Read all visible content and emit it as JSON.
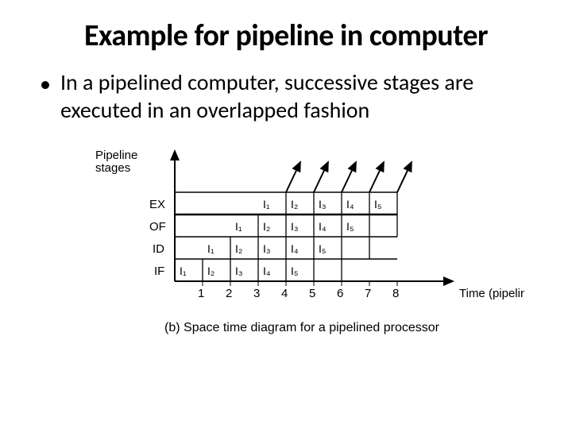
{
  "title": "Example for pipeline in computer",
  "bullet_text": "In a pipelined computer, successive stages are executed in an overlapped fashion",
  "diagram": {
    "y_axis_label": "Pipeline\nstages",
    "x_axis_label": "Time (pipeline cycle)",
    "caption": "(b) Space time diagram for a pipelined processor",
    "stages": [
      "EX",
      "OF",
      "ID",
      "IF"
    ],
    "cycles": [
      "1",
      "2",
      "3",
      "4",
      "5",
      "6",
      "7",
      "8"
    ],
    "cells": {
      "EX": [
        "",
        "",
        "",
        "I₁",
        "I₂",
        "I₃",
        "I₄",
        "I₅"
      ],
      "OF": [
        "",
        "",
        "I₁",
        "I₂",
        "I₃",
        "I₄",
        "I₅",
        ""
      ],
      "ID": [
        "",
        "I₁",
        "I₂",
        "I₃",
        "I₄",
        "I₅",
        "",
        ""
      ],
      "IF": [
        "I₁",
        "I₂",
        "I₃",
        "I₄",
        "I₅",
        "",
        "",
        ""
      ]
    }
  }
}
